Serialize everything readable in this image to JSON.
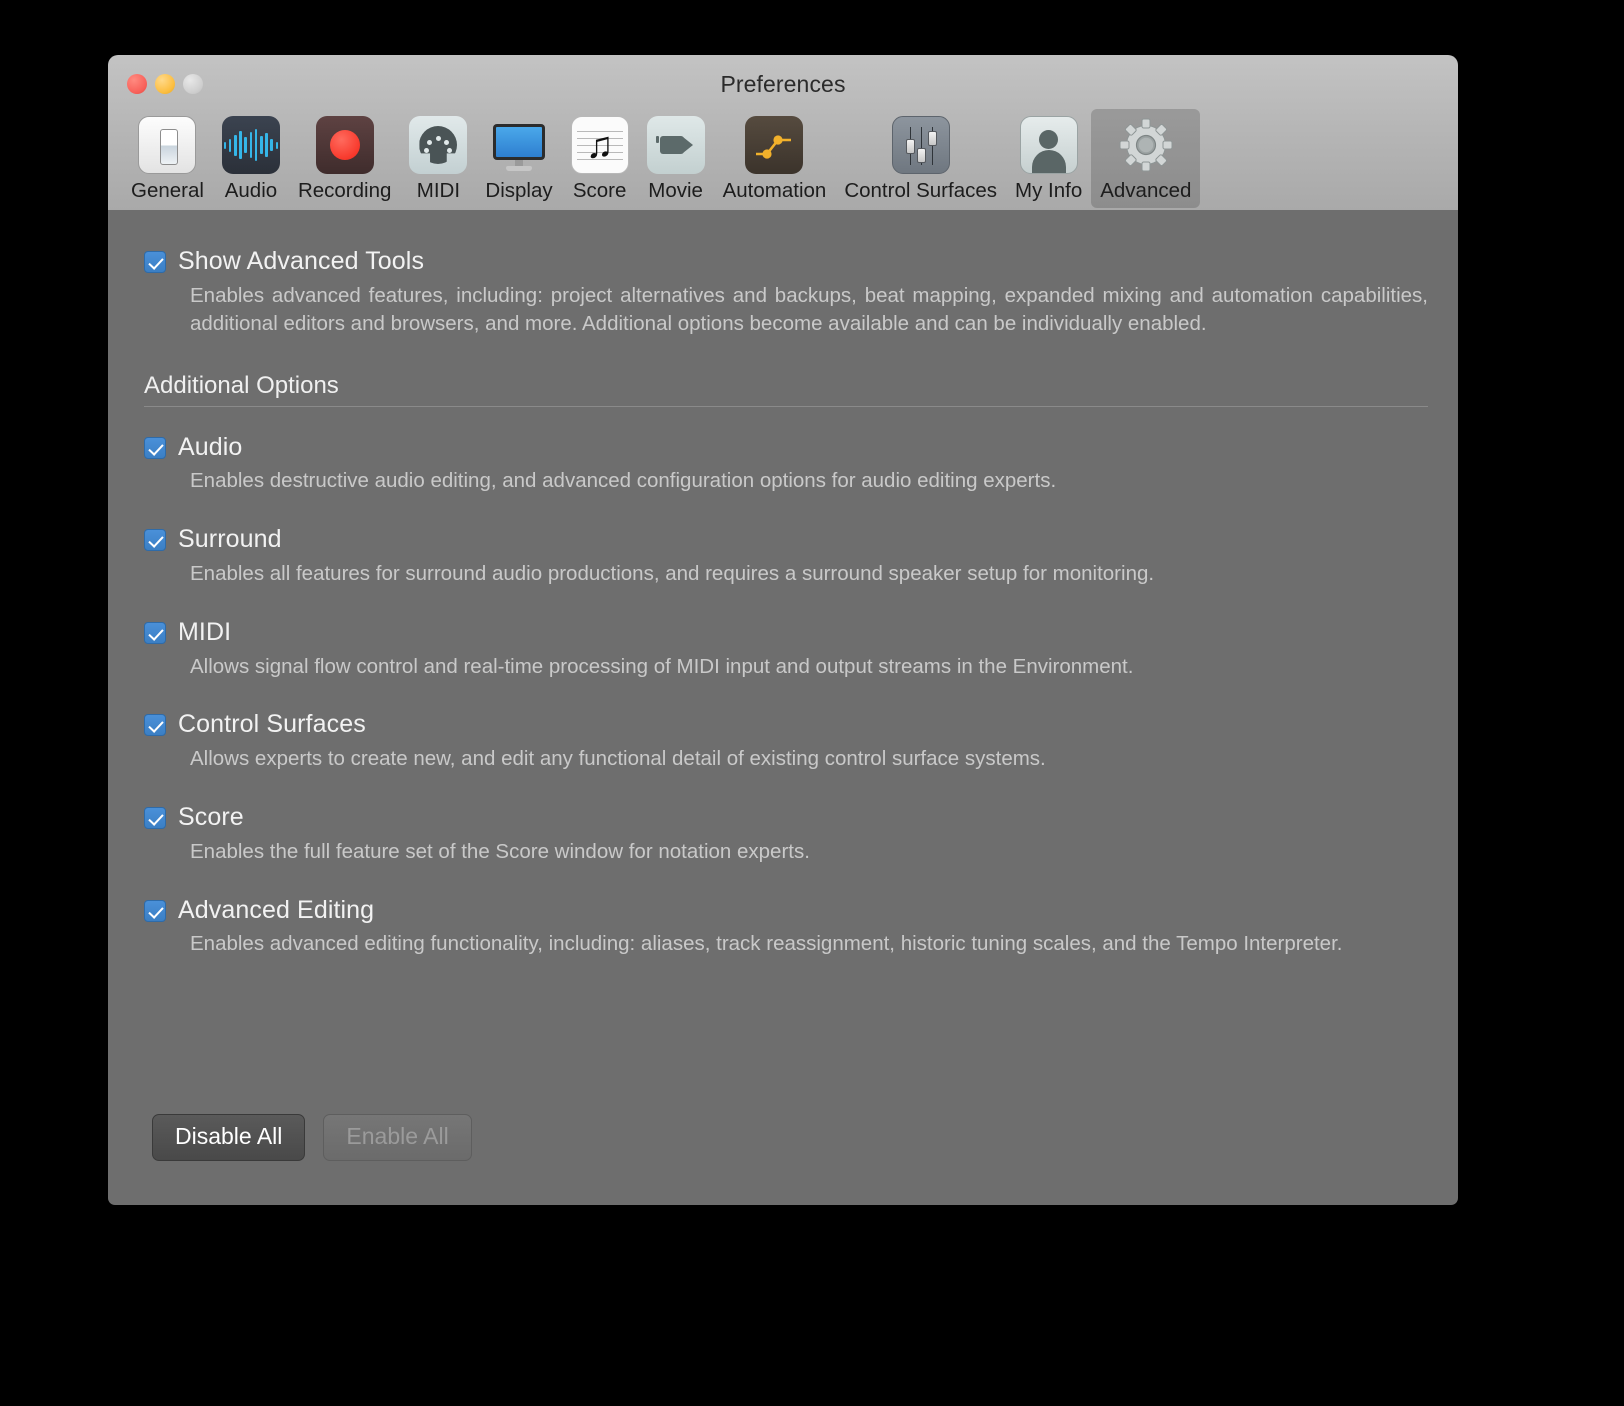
{
  "window": {
    "title": "Preferences",
    "traffic_lights": [
      "close-button",
      "minimize-button",
      "zoom-button"
    ]
  },
  "toolbar": {
    "tabs": [
      {
        "label": "General",
        "icon": "general-icon",
        "selected": false
      },
      {
        "label": "Audio",
        "icon": "audio-waveform-icon",
        "selected": false
      },
      {
        "label": "Recording",
        "icon": "record-dot-icon",
        "selected": false
      },
      {
        "label": "MIDI",
        "icon": "midi-din-icon",
        "selected": false
      },
      {
        "label": "Display",
        "icon": "display-monitor-icon",
        "selected": false
      },
      {
        "label": "Score",
        "icon": "score-note-icon",
        "selected": false
      },
      {
        "label": "Movie",
        "icon": "movie-camera-icon",
        "selected": false
      },
      {
        "label": "Automation",
        "icon": "automation-curve-icon",
        "selected": false
      },
      {
        "label": "Control Surfaces",
        "icon": "faders-icon",
        "selected": false
      },
      {
        "label": "My Info",
        "icon": "person-avatar-icon",
        "selected": false
      },
      {
        "label": "Advanced",
        "icon": "gear-icon",
        "selected": true
      }
    ]
  },
  "main": {
    "show_advanced_tools": {
      "label": "Show Advanced Tools",
      "checked": true,
      "description": "Enables advanced features, including: project alternatives and backups, beat mapping, expanded mixing and automation capabilities, additional editors and browsers, and more. Additional options become available and can be individually enabled."
    },
    "section_title": "Additional Options",
    "options": [
      {
        "label": "Audio",
        "checked": true,
        "description": "Enables destructive audio editing, and advanced configuration options for audio editing experts."
      },
      {
        "label": "Surround",
        "checked": true,
        "description": "Enables all features for surround audio productions, and requires a surround speaker setup for monitoring."
      },
      {
        "label": "MIDI",
        "checked": true,
        "description": "Allows signal flow control and real-time processing of MIDI input and output streams in the Environment."
      },
      {
        "label": "Control Surfaces",
        "checked": true,
        "description": "Allows experts to create new, and edit any functional detail of existing control surface systems."
      },
      {
        "label": "Score",
        "checked": true,
        "description": "Enables the full feature set of the Score window for notation experts."
      },
      {
        "label": "Advanced Editing",
        "checked": true,
        "description": "Enables advanced editing functionality, including: aliases, track reassignment, historic tuning scales, and the Tempo Interpreter."
      }
    ],
    "buttons": {
      "disable_all": "Disable All",
      "enable_all": "Enable All"
    }
  },
  "colors": {
    "checkbox_blue": "#4a90d9",
    "window_body": "#6e6e6e",
    "chrome": "#b4b4b4",
    "title_text": "#2b2b2b",
    "option_title": "#f2f2f2",
    "option_desc": "#c9c9c9"
  }
}
